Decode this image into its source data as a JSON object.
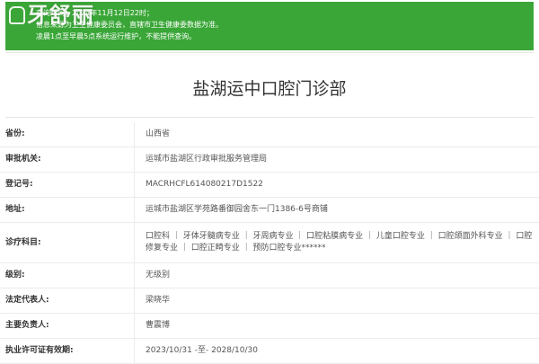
{
  "notice": {
    "lines": [
      "查询时间：2024年11月12日22时；",
      "信息来源为卫生健康委员会，直辖市卫生健康委数据为准。",
      "凌晨1点至早晨5点系统运行维护，不能提供查询。"
    ]
  },
  "logo": {
    "text": "牙舒丽"
  },
  "page": {
    "title": "盐湖运中口腔门诊部"
  },
  "info": {
    "rows": [
      {
        "label": "省份:",
        "value": "山西省"
      },
      {
        "label": "审批机关:",
        "value": "运城市盐湖区行政审批服务管理局"
      },
      {
        "label": "登记号:",
        "value": "MACRHCFL614080217D1522"
      },
      {
        "label": "地址:",
        "value": "运城市盐湖区学苑路番御园舍东一门1386-6号商铺"
      },
      {
        "label": "诊疗科目:",
        "value": "口腔科 ｜ 牙体牙髓病专业 ｜ 牙周病专业 ｜ 口腔粘膜病专业 ｜ 儿童口腔专业 ｜ 口腔颌面外科专业 ｜ 口腔修复专业 ｜ 口腔正畸专业 ｜ 预防口腔专业******"
      },
      {
        "label": "级别:",
        "value": "无级别"
      },
      {
        "label": "法定代表人:",
        "value": "梁晓华"
      },
      {
        "label": "主要负责人:",
        "value": "曹震博"
      },
      {
        "label": "执业许可证有效期:",
        "value": "2023/10/31 -至- 2028/10/30"
      }
    ]
  }
}
